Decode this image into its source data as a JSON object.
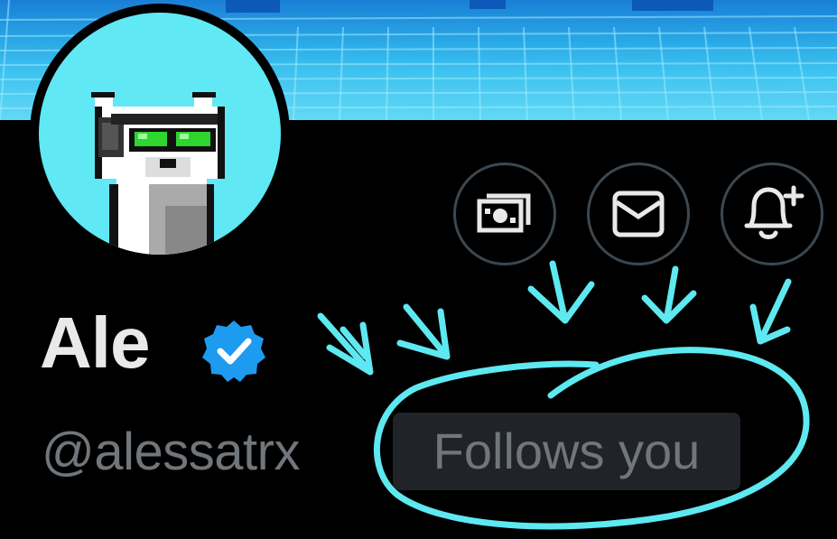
{
  "profile": {
    "display_name": "Ale",
    "handle": "@alessatrx",
    "follows_you_label": "Follows you",
    "verified": true
  },
  "actions": [
    {
      "name": "tip",
      "icon": "money-icon"
    },
    {
      "name": "message",
      "icon": "mail-icon"
    },
    {
      "name": "notify",
      "icon": "bell-plus-icon"
    }
  ],
  "colors": {
    "background": "#000000",
    "name_text": "#e7e9ea",
    "secondary_text": "#71767b",
    "verified_blue": "#1d9bf0",
    "badge_bg": "#202327",
    "avatar_bg": "#60e8f4",
    "annotation": "#5ee8f0"
  }
}
